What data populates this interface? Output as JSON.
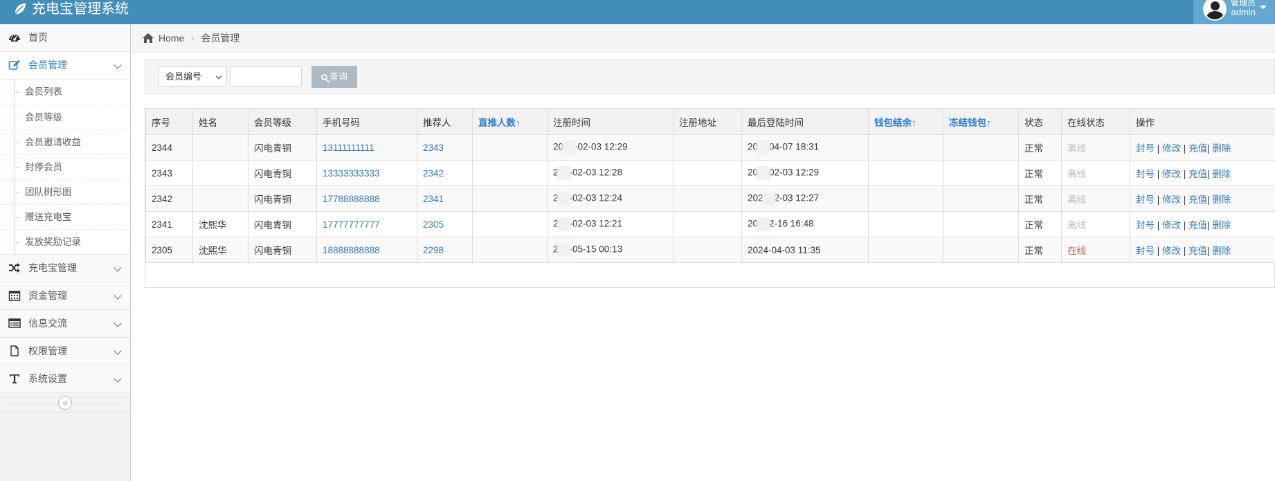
{
  "app": {
    "title": "充电宝管理系统"
  },
  "user": {
    "role": "管理员",
    "name": "admin"
  },
  "sidebar": {
    "items": [
      {
        "label": "首页",
        "icon": "dashboard-icon"
      },
      {
        "label": "会员管理",
        "icon": "edit-icon",
        "expanded": true,
        "children": [
          "会员列表",
          "会员等级",
          "会员邀请收益",
          "封停会员",
          "团队树形图",
          "赠送充电宝",
          "发放奖励记录"
        ]
      },
      {
        "label": "充电宝管理",
        "icon": "random-icon"
      },
      {
        "label": "资金管理",
        "icon": "calendar-icon"
      },
      {
        "label": "信息交流",
        "icon": "list-icon"
      },
      {
        "label": "权限管理",
        "icon": "file-icon"
      },
      {
        "label": "系统设置",
        "icon": "text-icon"
      }
    ],
    "collapse_glyph": "«"
  },
  "breadcrumb": {
    "home": "Home",
    "current": "会员管理"
  },
  "search": {
    "select_value": "会员编号",
    "input_value": "",
    "button_label": "查询"
  },
  "table": {
    "headers": [
      "序号",
      "姓名",
      "会员等级",
      "手机号码",
      "推荐人",
      "直推人数↑",
      "注册时间",
      "注册地址",
      "最后登陆时间",
      "钱包结余↑",
      "冻结钱包↑",
      "状态",
      "在线状态",
      "操作"
    ],
    "rows": [
      {
        "id": "2344",
        "name": "",
        "level": "闪电青铜",
        "phone": "13111111111",
        "referrer": "2343",
        "direct": "",
        "reg_a": "20",
        "reg_b": "-02-03 12:29",
        "addr": "",
        "last_a": "20",
        "last_b": "04-07 18:31",
        "wallet": "",
        "frozen": "",
        "status": "正常",
        "online": "离线"
      },
      {
        "id": "2343",
        "name": "",
        "level": "闪电青铜",
        "phone": "13333333333",
        "referrer": "2342",
        "direct": "",
        "reg_a": "2",
        "reg_b": "-02-03 12:28",
        "addr": "",
        "last_a": "20",
        "last_b": "02-03 12:29",
        "wallet": "",
        "frozen": "",
        "status": "正常",
        "online": "离线"
      },
      {
        "id": "2342",
        "name": "",
        "level": "闪电青铜",
        "phone": "17788888888",
        "referrer": "2341",
        "direct": "",
        "reg_a": "2",
        "reg_b": "-02-03 12:24",
        "addr": "",
        "last_a": "202",
        "last_b": "2-03 12:27",
        "wallet": "",
        "frozen": "",
        "status": "正常",
        "online": "离线"
      },
      {
        "id": "2341",
        "name": "沈熙华",
        "level": "闪电青铜",
        "phone": "17777777777",
        "referrer": "2305",
        "direct": "",
        "reg_a": "2",
        "reg_b": "-02-03 12:21",
        "addr": "",
        "last_a": "20",
        "last_b": "2-16 16:48",
        "wallet": "",
        "frozen": "",
        "status": "正常",
        "online": "离线"
      },
      {
        "id": "2305",
        "name": "沈熙华",
        "level": "闪电青铜",
        "phone": "18888888888",
        "referrer": "2298",
        "direct": "",
        "reg_a": "2",
        "reg_b": "-05-15 00:13",
        "addr": "",
        "last_a": "2024-04-03 11:35",
        "last_b": "",
        "wallet": "",
        "frozen": "",
        "status": "正常",
        "online": "在线"
      }
    ],
    "ops": [
      "封号",
      "修改",
      "充值",
      "删除"
    ]
  },
  "colors": {
    "navbar": "#438eb9",
    "user_box": "#62a8d1",
    "link": "#337ab7",
    "online": "#d15b47",
    "offline": "#bbbbbb",
    "button": "#abbac3"
  }
}
